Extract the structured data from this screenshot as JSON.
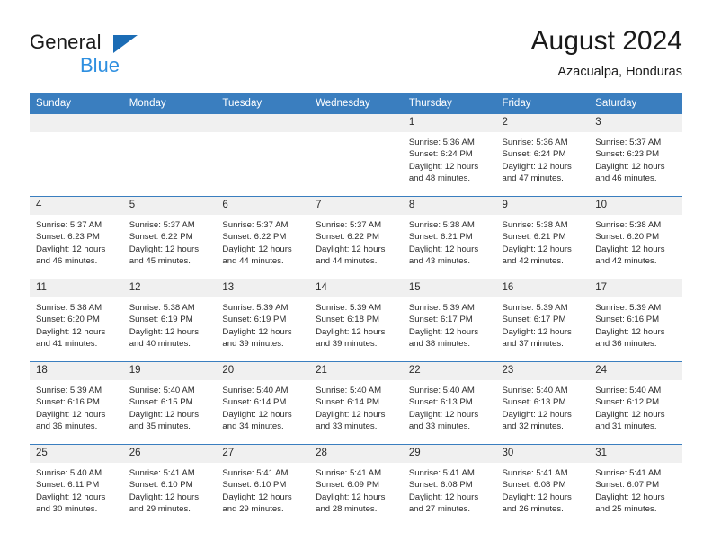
{
  "brand": {
    "name_top": "General",
    "name_bottom": "Blue",
    "flag_color": "#1b6cb5",
    "blue_text_color": "#2e8fe0"
  },
  "header": {
    "month_title": "August 2024",
    "location": "Azacualpa, Honduras",
    "header_bg": "#3a7ebf",
    "daynum_bg": "#f0f0f0"
  },
  "weekday_headers": [
    "Sunday",
    "Monday",
    "Tuesday",
    "Wednesday",
    "Thursday",
    "Friday",
    "Saturday"
  ],
  "weeks": [
    [
      {
        "day": "",
        "lines": []
      },
      {
        "day": "",
        "lines": []
      },
      {
        "day": "",
        "lines": []
      },
      {
        "day": "",
        "lines": []
      },
      {
        "day": "1",
        "lines": [
          "Sunrise: 5:36 AM",
          "Sunset: 6:24 PM",
          "Daylight: 12 hours",
          "and 48 minutes."
        ]
      },
      {
        "day": "2",
        "lines": [
          "Sunrise: 5:36 AM",
          "Sunset: 6:24 PM",
          "Daylight: 12 hours",
          "and 47 minutes."
        ]
      },
      {
        "day": "3",
        "lines": [
          "Sunrise: 5:37 AM",
          "Sunset: 6:23 PM",
          "Daylight: 12 hours",
          "and 46 minutes."
        ]
      }
    ],
    [
      {
        "day": "4",
        "lines": [
          "Sunrise: 5:37 AM",
          "Sunset: 6:23 PM",
          "Daylight: 12 hours",
          "and 46 minutes."
        ]
      },
      {
        "day": "5",
        "lines": [
          "Sunrise: 5:37 AM",
          "Sunset: 6:22 PM",
          "Daylight: 12 hours",
          "and 45 minutes."
        ]
      },
      {
        "day": "6",
        "lines": [
          "Sunrise: 5:37 AM",
          "Sunset: 6:22 PM",
          "Daylight: 12 hours",
          "and 44 minutes."
        ]
      },
      {
        "day": "7",
        "lines": [
          "Sunrise: 5:37 AM",
          "Sunset: 6:22 PM",
          "Daylight: 12 hours",
          "and 44 minutes."
        ]
      },
      {
        "day": "8",
        "lines": [
          "Sunrise: 5:38 AM",
          "Sunset: 6:21 PM",
          "Daylight: 12 hours",
          "and 43 minutes."
        ]
      },
      {
        "day": "9",
        "lines": [
          "Sunrise: 5:38 AM",
          "Sunset: 6:21 PM",
          "Daylight: 12 hours",
          "and 42 minutes."
        ]
      },
      {
        "day": "10",
        "lines": [
          "Sunrise: 5:38 AM",
          "Sunset: 6:20 PM",
          "Daylight: 12 hours",
          "and 42 minutes."
        ]
      }
    ],
    [
      {
        "day": "11",
        "lines": [
          "Sunrise: 5:38 AM",
          "Sunset: 6:20 PM",
          "Daylight: 12 hours",
          "and 41 minutes."
        ]
      },
      {
        "day": "12",
        "lines": [
          "Sunrise: 5:38 AM",
          "Sunset: 6:19 PM",
          "Daylight: 12 hours",
          "and 40 minutes."
        ]
      },
      {
        "day": "13",
        "lines": [
          "Sunrise: 5:39 AM",
          "Sunset: 6:19 PM",
          "Daylight: 12 hours",
          "and 39 minutes."
        ]
      },
      {
        "day": "14",
        "lines": [
          "Sunrise: 5:39 AM",
          "Sunset: 6:18 PM",
          "Daylight: 12 hours",
          "and 39 minutes."
        ]
      },
      {
        "day": "15",
        "lines": [
          "Sunrise: 5:39 AM",
          "Sunset: 6:17 PM",
          "Daylight: 12 hours",
          "and 38 minutes."
        ]
      },
      {
        "day": "16",
        "lines": [
          "Sunrise: 5:39 AM",
          "Sunset: 6:17 PM",
          "Daylight: 12 hours",
          "and 37 minutes."
        ]
      },
      {
        "day": "17",
        "lines": [
          "Sunrise: 5:39 AM",
          "Sunset: 6:16 PM",
          "Daylight: 12 hours",
          "and 36 minutes."
        ]
      }
    ],
    [
      {
        "day": "18",
        "lines": [
          "Sunrise: 5:39 AM",
          "Sunset: 6:16 PM",
          "Daylight: 12 hours",
          "and 36 minutes."
        ]
      },
      {
        "day": "19",
        "lines": [
          "Sunrise: 5:40 AM",
          "Sunset: 6:15 PM",
          "Daylight: 12 hours",
          "and 35 minutes."
        ]
      },
      {
        "day": "20",
        "lines": [
          "Sunrise: 5:40 AM",
          "Sunset: 6:14 PM",
          "Daylight: 12 hours",
          "and 34 minutes."
        ]
      },
      {
        "day": "21",
        "lines": [
          "Sunrise: 5:40 AM",
          "Sunset: 6:14 PM",
          "Daylight: 12 hours",
          "and 33 minutes."
        ]
      },
      {
        "day": "22",
        "lines": [
          "Sunrise: 5:40 AM",
          "Sunset: 6:13 PM",
          "Daylight: 12 hours",
          "and 33 minutes."
        ]
      },
      {
        "day": "23",
        "lines": [
          "Sunrise: 5:40 AM",
          "Sunset: 6:13 PM",
          "Daylight: 12 hours",
          "and 32 minutes."
        ]
      },
      {
        "day": "24",
        "lines": [
          "Sunrise: 5:40 AM",
          "Sunset: 6:12 PM",
          "Daylight: 12 hours",
          "and 31 minutes."
        ]
      }
    ],
    [
      {
        "day": "25",
        "lines": [
          "Sunrise: 5:40 AM",
          "Sunset: 6:11 PM",
          "Daylight: 12 hours",
          "and 30 minutes."
        ]
      },
      {
        "day": "26",
        "lines": [
          "Sunrise: 5:41 AM",
          "Sunset: 6:10 PM",
          "Daylight: 12 hours",
          "and 29 minutes."
        ]
      },
      {
        "day": "27",
        "lines": [
          "Sunrise: 5:41 AM",
          "Sunset: 6:10 PM",
          "Daylight: 12 hours",
          "and 29 minutes."
        ]
      },
      {
        "day": "28",
        "lines": [
          "Sunrise: 5:41 AM",
          "Sunset: 6:09 PM",
          "Daylight: 12 hours",
          "and 28 minutes."
        ]
      },
      {
        "day": "29",
        "lines": [
          "Sunrise: 5:41 AM",
          "Sunset: 6:08 PM",
          "Daylight: 12 hours",
          "and 27 minutes."
        ]
      },
      {
        "day": "30",
        "lines": [
          "Sunrise: 5:41 AM",
          "Sunset: 6:08 PM",
          "Daylight: 12 hours",
          "and 26 minutes."
        ]
      },
      {
        "day": "31",
        "lines": [
          "Sunrise: 5:41 AM",
          "Sunset: 6:07 PM",
          "Daylight: 12 hours",
          "and 25 minutes."
        ]
      }
    ]
  ]
}
